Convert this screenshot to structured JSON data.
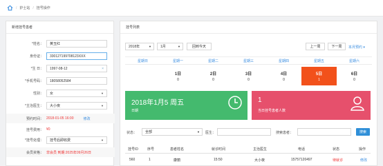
{
  "breadcrumb": {
    "items": [
      "护士站",
      "挂号操作"
    ],
    "sep": "/"
  },
  "left": {
    "title": "新增挂号患者",
    "name": {
      "label": "*姓名：",
      "value": "黄玉红"
    },
    "idcard": {
      "label": "身份证：",
      "value": "330127199708123XXX"
    },
    "birth": {
      "label": "*生 日：",
      "value": "1997-08-12",
      "clear": "×"
    },
    "phone": {
      "label": "*手机号码：",
      "value": "18058052584"
    },
    "gender": {
      "label": "性别：",
      "value": "女"
    },
    "doctor": {
      "label": "*主治医生：",
      "value": "大小夜"
    },
    "appt_time": {
      "label": "预约时间：",
      "value": "2018-01-05 16:00",
      "link": "修改"
    },
    "fee": {
      "label": "挂号费用：",
      "value": "¥0"
    },
    "process": {
      "label": "*挂号处理：",
      "value": "挂号后即收费"
    },
    "member": {
      "label": "会员资格：",
      "value": "非会员 到期:2025年09月26日"
    }
  },
  "right": {
    "title": "挂号列表",
    "year": "2018年",
    "month": "1月",
    "back_today": "回到今天",
    "prev": "上一周",
    "next": "下一周",
    "this_week": "本月预约 ▾",
    "weekdays": [
      "星期日",
      "星期一",
      "星期二",
      "星期三",
      "星期四",
      "星期五",
      "星期六"
    ],
    "days": [
      {
        "num": "",
        "cnt": ""
      },
      {
        "num": "1日",
        "cnt": "0"
      },
      {
        "num": "2日",
        "cnt": "0"
      },
      {
        "num": "3日",
        "cnt": "0"
      },
      {
        "num": "4日",
        "cnt": "0"
      },
      {
        "num": "5日",
        "cnt": "1"
      },
      {
        "num": "6日",
        "cnt": "0"
      }
    ],
    "card_green": {
      "big": "2018年1月5 周五",
      "small": "日期"
    },
    "card_red": {
      "big": "1",
      "small": "当日挂号患者人数"
    },
    "filter": {
      "status_label": "状态：",
      "status_value": "全部",
      "doctor_label": "医生：",
      "patient_label": "搜索患者：",
      "search": "搜索"
    },
    "table": {
      "headers": [
        "挂号ID",
        "序号",
        "患者姓名",
        "就诊时间",
        "主治医生",
        "电话",
        "状态",
        "操作"
      ],
      "rows": [
        [
          "560",
          "1",
          "康丽",
          "15:50",
          "大小夜",
          "15757120497",
          "待就诊",
          "修改"
        ]
      ]
    }
  },
  "colors": {
    "accent": "#2f8fd8",
    "green": "#44ba6e",
    "red": "#e6506c",
    "today": "#f2511b"
  }
}
